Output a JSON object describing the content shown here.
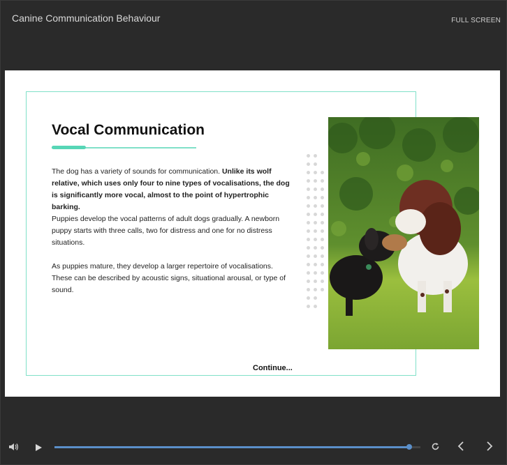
{
  "header": {
    "course_title": "Canine Communication Behaviour",
    "fullscreen_label": "FULL SCREEN"
  },
  "slide": {
    "heading": "Vocal Communication",
    "paragraphs": [
      {
        "plain": "The dog has a variety of sounds for communication. ",
        "bold": "Unlike its wolf relative, which uses only four to nine types of vocalisations, the dog is significantly more vocal, almost to the point of hypertrophic barking."
      },
      {
        "plain": "Puppies develop the vocal patterns of adult dogs gradually. A newborn puppy starts with three calls, two for distress and one for no distress situations."
      },
      {
        "plain": "As puppies mature, they develop a larger repertoire of vocalisations. These can be described by acoustic signs, situational arousal, or type of sound."
      }
    ],
    "continue_label": "Continue...",
    "accent_color": "#7fe0c8"
  },
  "player": {
    "progress": 0.97,
    "icons": {
      "volume": "volume-icon",
      "play": "play-icon",
      "replay": "replay-icon",
      "prev": "chevron-left-icon",
      "next": "chevron-right-icon"
    },
    "seek_color": "#5b8fc9"
  }
}
